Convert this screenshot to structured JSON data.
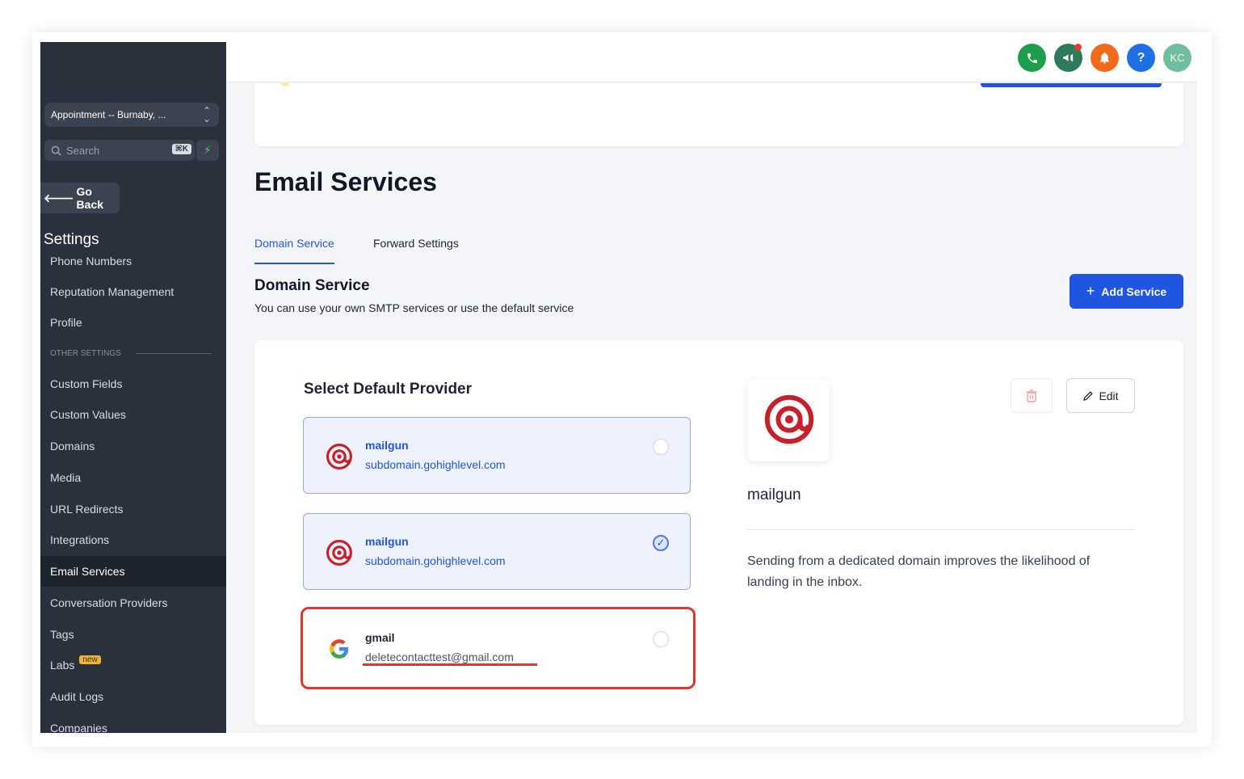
{
  "sidebar": {
    "location_switcher": "Appointment -- Burnaby, ...",
    "search_placeholder": "Search",
    "search_shortcut": "⌘K",
    "go_back": "Go Back",
    "title": "Settings",
    "items": [
      {
        "label": "Phone Numbers"
      },
      {
        "label": "Reputation Management"
      },
      {
        "label": "Profile"
      },
      {
        "label": "Custom Fields"
      },
      {
        "label": "Custom Values"
      },
      {
        "label": "Domains"
      },
      {
        "label": "Media"
      },
      {
        "label": "URL Redirects"
      },
      {
        "label": "Integrations"
      },
      {
        "label": "Email Services",
        "active": true
      },
      {
        "label": "Conversation Providers"
      },
      {
        "label": "Tags"
      },
      {
        "label": "Labs",
        "badge": "new"
      },
      {
        "label": "Audit Logs"
      },
      {
        "label": "Companies"
      }
    ],
    "section_label": "OTHER SETTINGS"
  },
  "topbar": {
    "icons": [
      "phone-icon",
      "megaphone-icon",
      "bell-icon",
      "help-icon",
      "avatar"
    ],
    "avatar_initials": "KC",
    "help_glyph": "?",
    "colors": {
      "phone": "#1e9e4a",
      "megaphone": "#2f7a5a",
      "bell": "#f26a1b",
      "help": "#1f6fe5",
      "avatar": "#6fbf9f"
    }
  },
  "page": {
    "title": "Email Services",
    "tabs": [
      {
        "label": "Domain Service",
        "active": true
      },
      {
        "label": "Forward Settings",
        "active": false
      }
    ],
    "section_title": "Domain Service",
    "section_description": "You can use your own SMTP services or use the default service",
    "add_button": "Add Service",
    "select_title": "Select Default Provider",
    "providers": [
      {
        "name": "mailgun",
        "domain": "subdomain.gohighlevel.com",
        "checked": false
      },
      {
        "name": "mailgun",
        "domain": "subdomain.gohighlevel.com",
        "checked": true
      },
      {
        "name": "gmail",
        "domain": "deletecontacttest@gmail.com",
        "checked": false
      }
    ],
    "detail": {
      "name": "mailgun",
      "description": "Sending from a dedicated domain improves the likelihood of landing in the inbox.",
      "edit_label": "Edit"
    }
  },
  "colors": {
    "accent": "#1f55e0",
    "sidebar_bg": "#2a313d",
    "highlight": "#d9392f",
    "mailgun": "#c8202a"
  }
}
